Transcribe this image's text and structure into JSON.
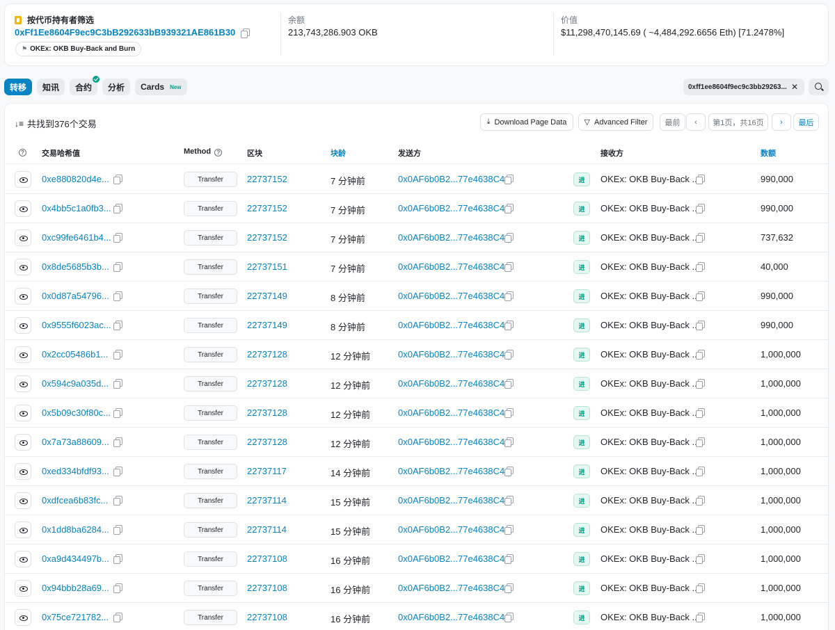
{
  "summary": {
    "filter_title": "按代币持有者筛选",
    "filter_address": "0xFf1Ee8604F9ec9C3bB292633bB939321AE861B30",
    "tag": "OKEx: OKB Buy-Back and Burn",
    "balance_label": "余额",
    "balance_value": "213,743,286.903 OKB",
    "value_label": "价值",
    "value_value": "$11,298,470,145.69 ( ~4,484,292.6656 Eth) [71.2478%]"
  },
  "tabs": [
    {
      "label": "转移",
      "active": true
    },
    {
      "label": "知讯"
    },
    {
      "label": "合约",
      "verified": true
    },
    {
      "label": "分析"
    },
    {
      "label": "Cards",
      "badge": "New"
    }
  ],
  "address_filter": "0xff1ee8604f9ec9c3bb29263...",
  "toolbar": {
    "found": "共找到376个交易",
    "download": "Download Page Data",
    "advanced_filter": "Advanced Filter",
    "first": "最前",
    "page": "第1页，共16页",
    "last": "最后"
  },
  "columns": {
    "hash": "交易哈希值",
    "method": "Method",
    "block": "区块",
    "age": "块龄",
    "from": "发送方",
    "to": "接收方",
    "qty": "数额"
  },
  "rows": [
    {
      "hash": "0xe880820d4e...",
      "method": "Transfer",
      "block": "22737152",
      "age": "7 分钟前",
      "from": "0x0AF6b0B2...77e4638C4",
      "dir": "进",
      "to": "OKEx: OKB Buy-Back ...",
      "qty": "990,000"
    },
    {
      "hash": "0x4bb5c1a0fb3...",
      "method": "Transfer",
      "block": "22737152",
      "age": "7 分钟前",
      "from": "0x0AF6b0B2...77e4638C4",
      "dir": "进",
      "to": "OKEx: OKB Buy-Back ...",
      "qty": "990,000"
    },
    {
      "hash": "0xc99fe6461b4...",
      "method": "Transfer",
      "block": "22737152",
      "age": "7 分钟前",
      "from": "0x0AF6b0B2...77e4638C4",
      "dir": "进",
      "to": "OKEx: OKB Buy-Back ...",
      "qty": "737,632"
    },
    {
      "hash": "0x8de5685b3b...",
      "method": "Transfer",
      "block": "22737151",
      "age": "7 分钟前",
      "from": "0x0AF6b0B2...77e4638C4",
      "dir": "进",
      "to": "OKEx: OKB Buy-Back ...",
      "qty": "40,000"
    },
    {
      "hash": "0x0d87a54796...",
      "method": "Transfer",
      "block": "22737149",
      "age": "8 分钟前",
      "from": "0x0AF6b0B2...77e4638C4",
      "dir": "进",
      "to": "OKEx: OKB Buy-Back ...",
      "qty": "990,000"
    },
    {
      "hash": "0x9555f6023ac...",
      "method": "Transfer",
      "block": "22737149",
      "age": "8 分钟前",
      "from": "0x0AF6b0B2...77e4638C4",
      "dir": "进",
      "to": "OKEx: OKB Buy-Back ...",
      "qty": "990,000"
    },
    {
      "hash": "0x2cc05486b1...",
      "method": "Transfer",
      "block": "22737128",
      "age": "12 分钟前",
      "from": "0x0AF6b0B2...77e4638C4",
      "dir": "进",
      "to": "OKEx: OKB Buy-Back ...",
      "qty": "1,000,000"
    },
    {
      "hash": "0x594c9a035d...",
      "method": "Transfer",
      "block": "22737128",
      "age": "12 分钟前",
      "from": "0x0AF6b0B2...77e4638C4",
      "dir": "进",
      "to": "OKEx: OKB Buy-Back ...",
      "qty": "1,000,000"
    },
    {
      "hash": "0x5b09c30f80c...",
      "method": "Transfer",
      "block": "22737128",
      "age": "12 分钟前",
      "from": "0x0AF6b0B2...77e4638C4",
      "dir": "进",
      "to": "OKEx: OKB Buy-Back ...",
      "qty": "1,000,000"
    },
    {
      "hash": "0x7a73a88609...",
      "method": "Transfer",
      "block": "22737128",
      "age": "12 分钟前",
      "from": "0x0AF6b0B2...77e4638C4",
      "dir": "进",
      "to": "OKEx: OKB Buy-Back ...",
      "qty": "1,000,000"
    },
    {
      "hash": "0xed334bfdf93...",
      "method": "Transfer",
      "block": "22737117",
      "age": "14 分钟前",
      "from": "0x0AF6b0B2...77e4638C4",
      "dir": "进",
      "to": "OKEx: OKB Buy-Back ...",
      "qty": "1,000,000"
    },
    {
      "hash": "0xdfcea6b83fc...",
      "method": "Transfer",
      "block": "22737114",
      "age": "15 分钟前",
      "from": "0x0AF6b0B2...77e4638C4",
      "dir": "进",
      "to": "OKEx: OKB Buy-Back ...",
      "qty": "1,000,000"
    },
    {
      "hash": "0x1dd8ba6284...",
      "method": "Transfer",
      "block": "22737114",
      "age": "15 分钟前",
      "from": "0x0AF6b0B2...77e4638C4",
      "dir": "进",
      "to": "OKEx: OKB Buy-Back ...",
      "qty": "1,000,000"
    },
    {
      "hash": "0xa9d434497b...",
      "method": "Transfer",
      "block": "22737108",
      "age": "16 分钟前",
      "from": "0x0AF6b0B2...77e4638C4",
      "dir": "进",
      "to": "OKEx: OKB Buy-Back ...",
      "qty": "1,000,000"
    },
    {
      "hash": "0x94bbb28a69...",
      "method": "Transfer",
      "block": "22737108",
      "age": "16 分钟前",
      "from": "0x0AF6b0B2...77e4638C4",
      "dir": "进",
      "to": "OKEx: OKB Buy-Back ...",
      "qty": "1,000,000"
    },
    {
      "hash": "0x75ce721782...",
      "method": "Transfer",
      "block": "22737108",
      "age": "16 分钟前",
      "from": "0x0AF6b0B2...77e4638C4",
      "dir": "进",
      "to": "OKEx: OKB Buy-Back ...",
      "qty": "1,000,000"
    }
  ]
}
